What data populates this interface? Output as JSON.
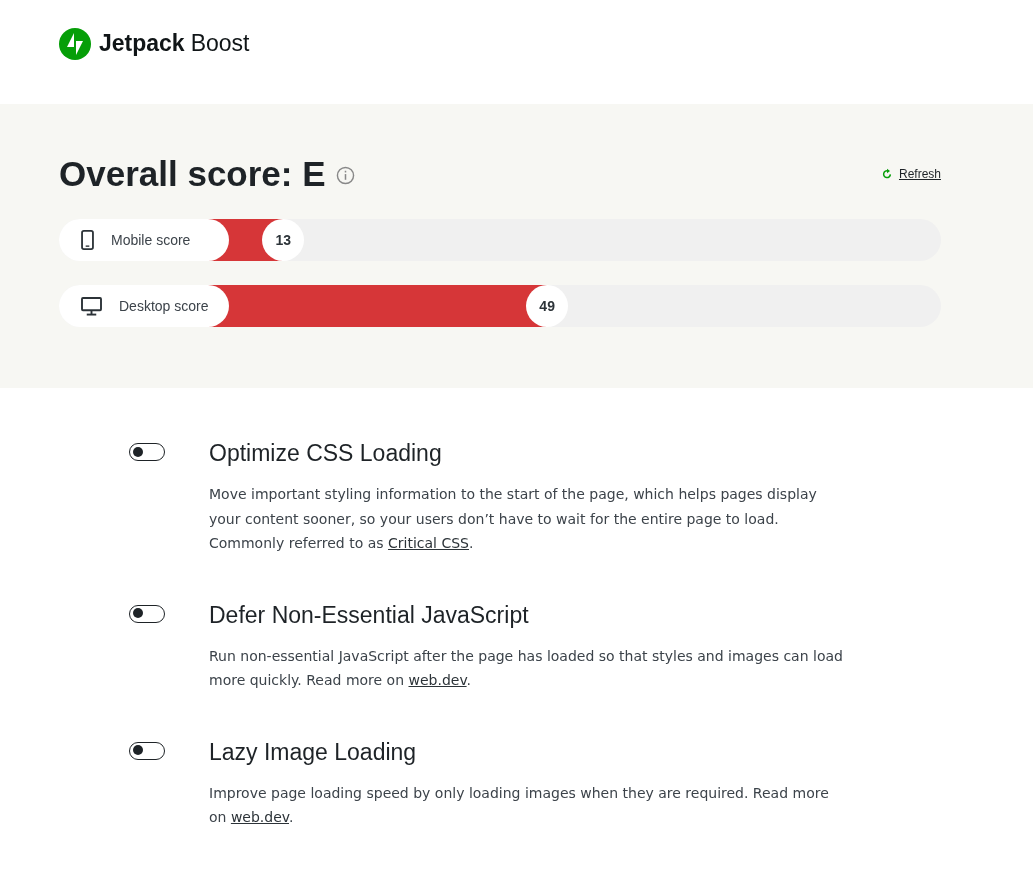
{
  "header": {
    "brand_bold": "Jetpack",
    "brand_light": "Boost"
  },
  "score": {
    "title": "Overall score: E",
    "refresh": "Refresh",
    "bars": [
      {
        "kind": "mobile",
        "label": "Mobile score",
        "value": "13"
      },
      {
        "kind": "desktop",
        "label": "Desktop score",
        "value": "49"
      }
    ]
  },
  "features": [
    {
      "title": "Optimize CSS Loading",
      "on": false,
      "description": {
        "before": "Move important styling information to the start of the page, which helps pages display your content sooner, so your users don’t have to wait for the entire page to load. Commonly referred to as ",
        "link": "Critical CSS",
        "after": "."
      }
    },
    {
      "title": "Defer Non-Essential JavaScript",
      "on": false,
      "description": {
        "before": "Run non-essential JavaScript after the page has loaded so that styles and images can load more quickly. Read more on ",
        "link": "web.dev",
        "after": "."
      }
    },
    {
      "title": "Lazy Image Loading",
      "on": false,
      "description": {
        "before": "Improve page loading speed by only loading images when they are required. Read more on ",
        "link": "web.dev",
        "after": "."
      }
    }
  ]
}
